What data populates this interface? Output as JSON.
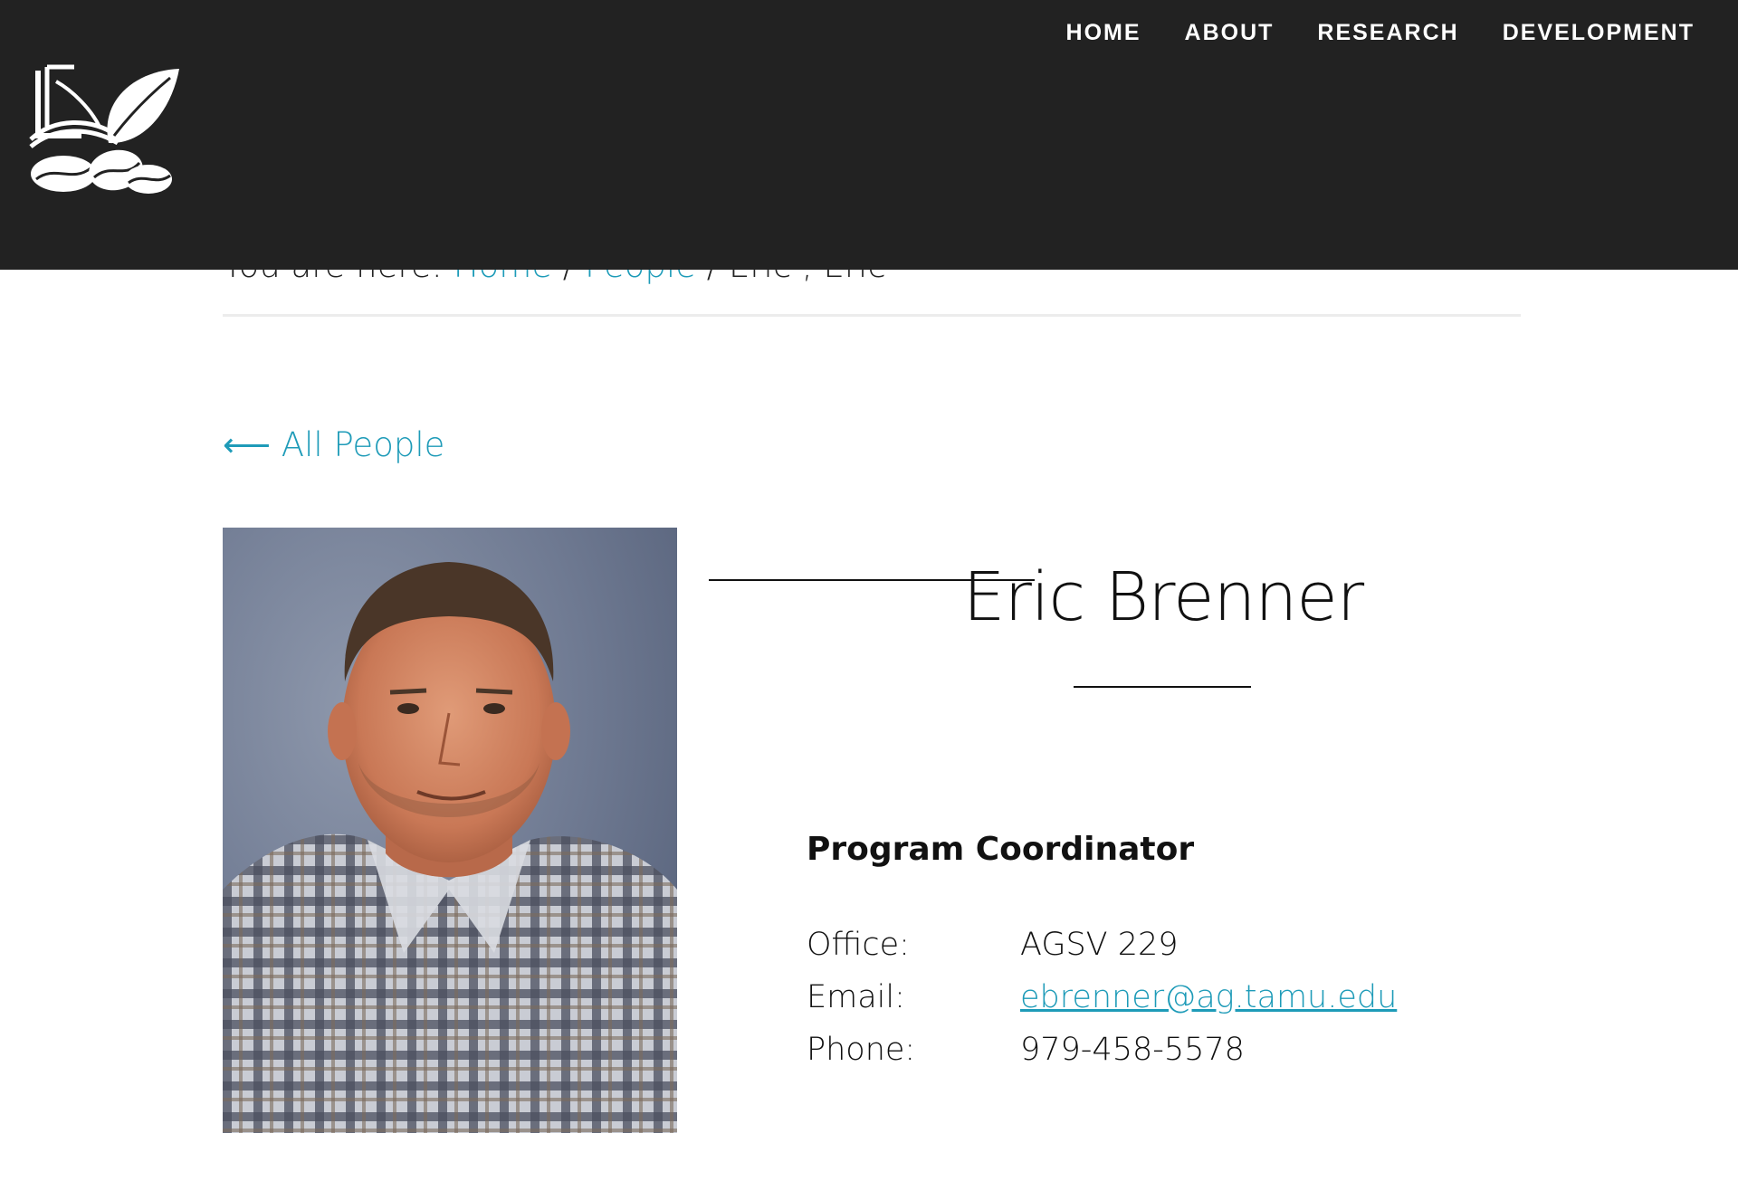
{
  "header": {
    "logo_name": "leaf-book-beans-logo",
    "nav": [
      "HOME",
      "ABOUT",
      "RESEARCH",
      "DEVELOPMENT"
    ]
  },
  "breadcrumb": {
    "prefix": "You are here: ",
    "home": "Home",
    "sep1": " / ",
    "people": "People",
    "sep2": " / ",
    "current": "Eric , Eric"
  },
  "back_link": {
    "arrow": "⟵",
    "label": " All People"
  },
  "profile": {
    "name": "Eric Brenner",
    "title": "Program Coordinator",
    "rows": [
      {
        "label": "Office:",
        "value": "AGSV 229"
      },
      {
        "label": "Email:",
        "value": "ebrenner@ag.tamu.edu"
      },
      {
        "label": "Phone:",
        "value": "979-458-5578"
      }
    ]
  },
  "colors": {
    "header_bg": "#222222",
    "link": "#1e9bb8",
    "text": "#111111"
  }
}
